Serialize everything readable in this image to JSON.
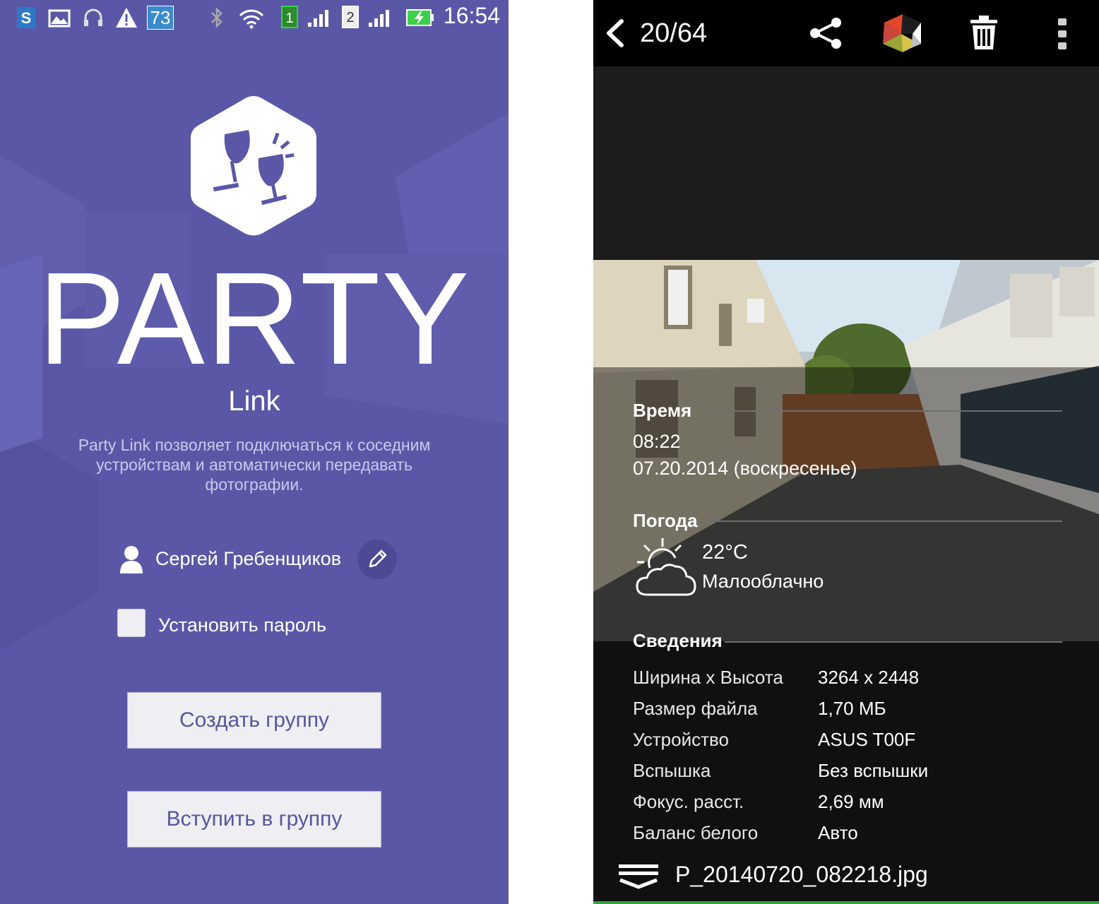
{
  "left_screen": {
    "status_bar": {
      "time": "16:54",
      "badge_number": "73",
      "sim1": "1",
      "sim2": "2",
      "icons": [
        "s-app-icon",
        "gallery-icon",
        "headset-icon",
        "warning-icon",
        "weather-badge-icon",
        "bluetooth-icon",
        "wifi-icon",
        "sim1-signal-icon",
        "sim2-signal-icon",
        "battery-charging-icon"
      ]
    },
    "app_title": "PARTY",
    "app_subtitle": "Link",
    "description": "Party Link позволяет подключаться к соседним устройствам и автоматически передавать фотографии.",
    "user_name": "Сергей Гребенщиков",
    "password_checkbox_label": "Установить пароль",
    "password_checked": false,
    "create_group_button": "Создать группу",
    "join_group_button": "Вступить в группу",
    "colors": {
      "background": "#5a58a6",
      "button_text": "#57559e"
    }
  },
  "right_screen": {
    "counter": "20/64",
    "toolbar_icons": [
      "back-icon",
      "share-icon",
      "app-logo-icon",
      "trash-icon",
      "overflow-menu-icon"
    ],
    "time_section": {
      "heading": "Время",
      "time": "08:22",
      "date": "07.20.2014 (воскресенье)"
    },
    "weather_section": {
      "heading": "Погода",
      "temperature": "22°C",
      "condition": "Малооблачно"
    },
    "details_section": {
      "heading": "Сведения",
      "rows": [
        {
          "label": "Ширина x Высота",
          "value": "3264 x 2448"
        },
        {
          "label": "Размер файла",
          "value": "1,70 МБ"
        },
        {
          "label": "Устройство",
          "value": "ASUS T00F"
        },
        {
          "label": "Вспышка",
          "value": "Без вспышки"
        },
        {
          "label": "Фокус. расст.",
          "value": "2,69 мм"
        },
        {
          "label": "Баланс белого",
          "value": "Авто"
        }
      ]
    },
    "filename": "P_20140720_082218.jpg"
  }
}
